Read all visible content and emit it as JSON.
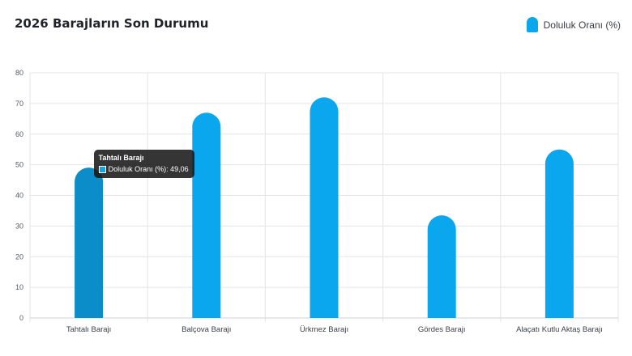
{
  "header": {
    "title": "2026 Barajların Son Durumu"
  },
  "colors": {
    "bar": "#0aa7ee",
    "bar_active": "#0a8dc8",
    "grid": "#e3e5e8"
  },
  "chart_data": {
    "type": "bar",
    "title": "2026 Barajların Son Durumu",
    "categories": [
      "Tahtalı Barajı",
      "Balçova Barajı",
      "Ürkmez Barajı",
      "Gördes Barajı",
      "Alaçatı Kutlu Aktaş Barajı"
    ],
    "series": [
      {
        "name": "Doluluk Oranı (%)",
        "values": [
          49.06,
          67,
          72,
          33.5,
          55
        ]
      }
    ],
    "ylim": [
      0,
      80
    ],
    "yticks": [
      0,
      10,
      20,
      30,
      40,
      50,
      60,
      70,
      80
    ],
    "grid": true,
    "legend_position": "top-right",
    "tooltip": {
      "category": "Tahtalı Barajı",
      "text": "Doluluk Oranı (%): 49,06"
    }
  }
}
